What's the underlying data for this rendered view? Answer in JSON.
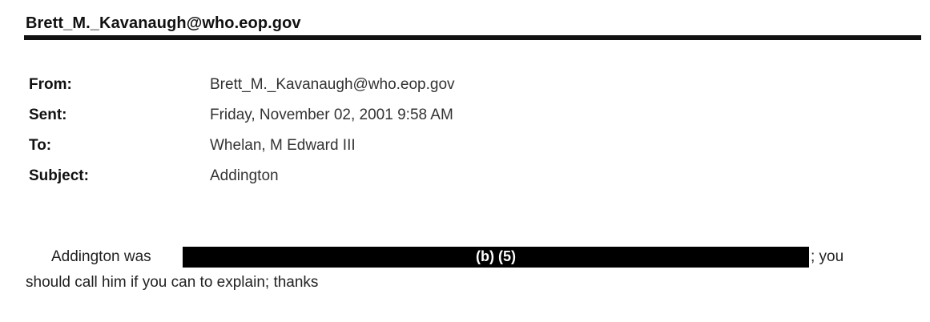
{
  "header": {
    "sender": "Brett_M._Kavanaugh@who.eop.gov"
  },
  "fields": {
    "from_label": "From:",
    "from_value": "Brett_M._Kavanaugh@who.eop.gov",
    "sent_label": "Sent:",
    "sent_value": "Friday, November 02, 2001 9:58 AM",
    "to_label": "To:",
    "to_value": "Whelan, M Edward III",
    "subject_label": "Subject:",
    "subject_value": "Addington"
  },
  "body": {
    "line1_start": "Addington was",
    "redaction_label": "(b) (5)",
    "line1_end": "; you",
    "line2": "should call him if you can to explain; thanks"
  }
}
